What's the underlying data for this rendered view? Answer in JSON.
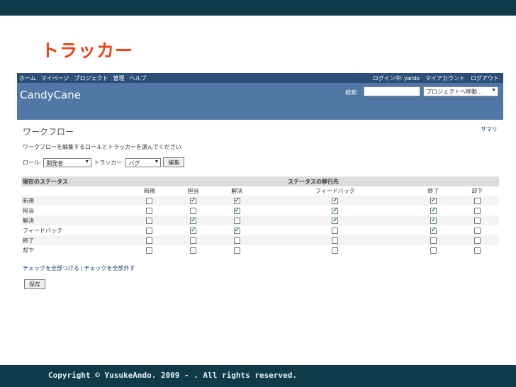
{
  "slide": {
    "title": "トラッカー",
    "copyright": "Copyright © YusukeAndo. 2009 - . All rights reserved."
  },
  "app": {
    "topnav": {
      "left": [
        "ホーム",
        "マイページ",
        "プロジェクト",
        "管理",
        "ヘルプ"
      ],
      "logged_in": "ログイン中: yando",
      "my_account": "マイアカウント",
      "logout": "ログアウト"
    },
    "header": {
      "name": "CandyCane",
      "search_label": "検索:",
      "search_value": "",
      "project_jump": "プロジェクトへ移動..."
    },
    "page": {
      "heading": "ワークフロー",
      "summary_link": "サマリ",
      "instruction": "ワークフローを編集するロールとトラッカーを選んでください:",
      "role_label": "ロール:",
      "role_value": "開発者",
      "tracker_label": "トラッカー:",
      "tracker_value": "バグ",
      "edit_button": "編集"
    },
    "table": {
      "current_status_header": "現在のステータス",
      "new_status_header": "ステータスの移行先",
      "columns": [
        "新規",
        "担当",
        "解決",
        "フィードバック",
        "終了",
        "却下"
      ],
      "rows": [
        {
          "name": "新規",
          "checks": [
            false,
            true,
            true,
            true,
            true,
            false
          ]
        },
        {
          "name": "担当",
          "checks": [
            false,
            false,
            true,
            true,
            true,
            false
          ]
        },
        {
          "name": "解決",
          "checks": [
            false,
            true,
            false,
            true,
            true,
            false
          ]
        },
        {
          "name": "フィードバック",
          "checks": [
            false,
            true,
            true,
            false,
            true,
            false
          ]
        },
        {
          "name": "終了",
          "checks": [
            false,
            false,
            false,
            false,
            false,
            false
          ]
        },
        {
          "name": "却下",
          "checks": [
            false,
            false,
            false,
            false,
            false,
            false
          ]
        }
      ]
    },
    "footer_links": {
      "check_all": "チェックを全部つける",
      "separator": "|",
      "uncheck_all": "チェックを全部外す"
    },
    "save_button": "保存"
  }
}
